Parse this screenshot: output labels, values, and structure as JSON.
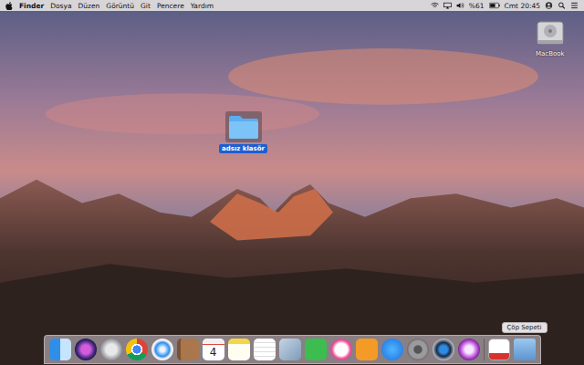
{
  "menu_bar": {
    "app": "Finder",
    "menus": [
      "Dosya",
      "Düzen",
      "Görüntü",
      "Git",
      "Pencere",
      "Yardım"
    ],
    "battery": "%61",
    "clock": "Cmt 20:45"
  },
  "desktop_icons": [
    {
      "label": "MacBook",
      "kind": "drive",
      "selected": false
    },
    {
      "label": "adsız klasör",
      "kind": "folder",
      "selected": true
    }
  ],
  "dock": {
    "items": [
      {
        "kind": "finder"
      },
      {
        "kind": "siri"
      },
      {
        "kind": "launchpad"
      },
      {
        "kind": "chrome"
      },
      {
        "kind": "safari"
      },
      {
        "kind": "contacts"
      },
      {
        "kind": "calendar",
        "text": "4"
      },
      {
        "kind": "notes"
      },
      {
        "kind": "reminders"
      },
      {
        "kind": "preview"
      },
      {
        "kind": "facetime"
      },
      {
        "kind": "itunes"
      },
      {
        "kind": "ibooks"
      },
      {
        "kind": "appstore"
      },
      {
        "kind": "settings"
      },
      {
        "kind": "quicktime"
      },
      {
        "kind": "photobooth"
      },
      {
        "kind": "separator"
      },
      {
        "kind": "textedit"
      },
      {
        "kind": "trash",
        "tooltip": "Çöp Sepeti"
      }
    ]
  }
}
